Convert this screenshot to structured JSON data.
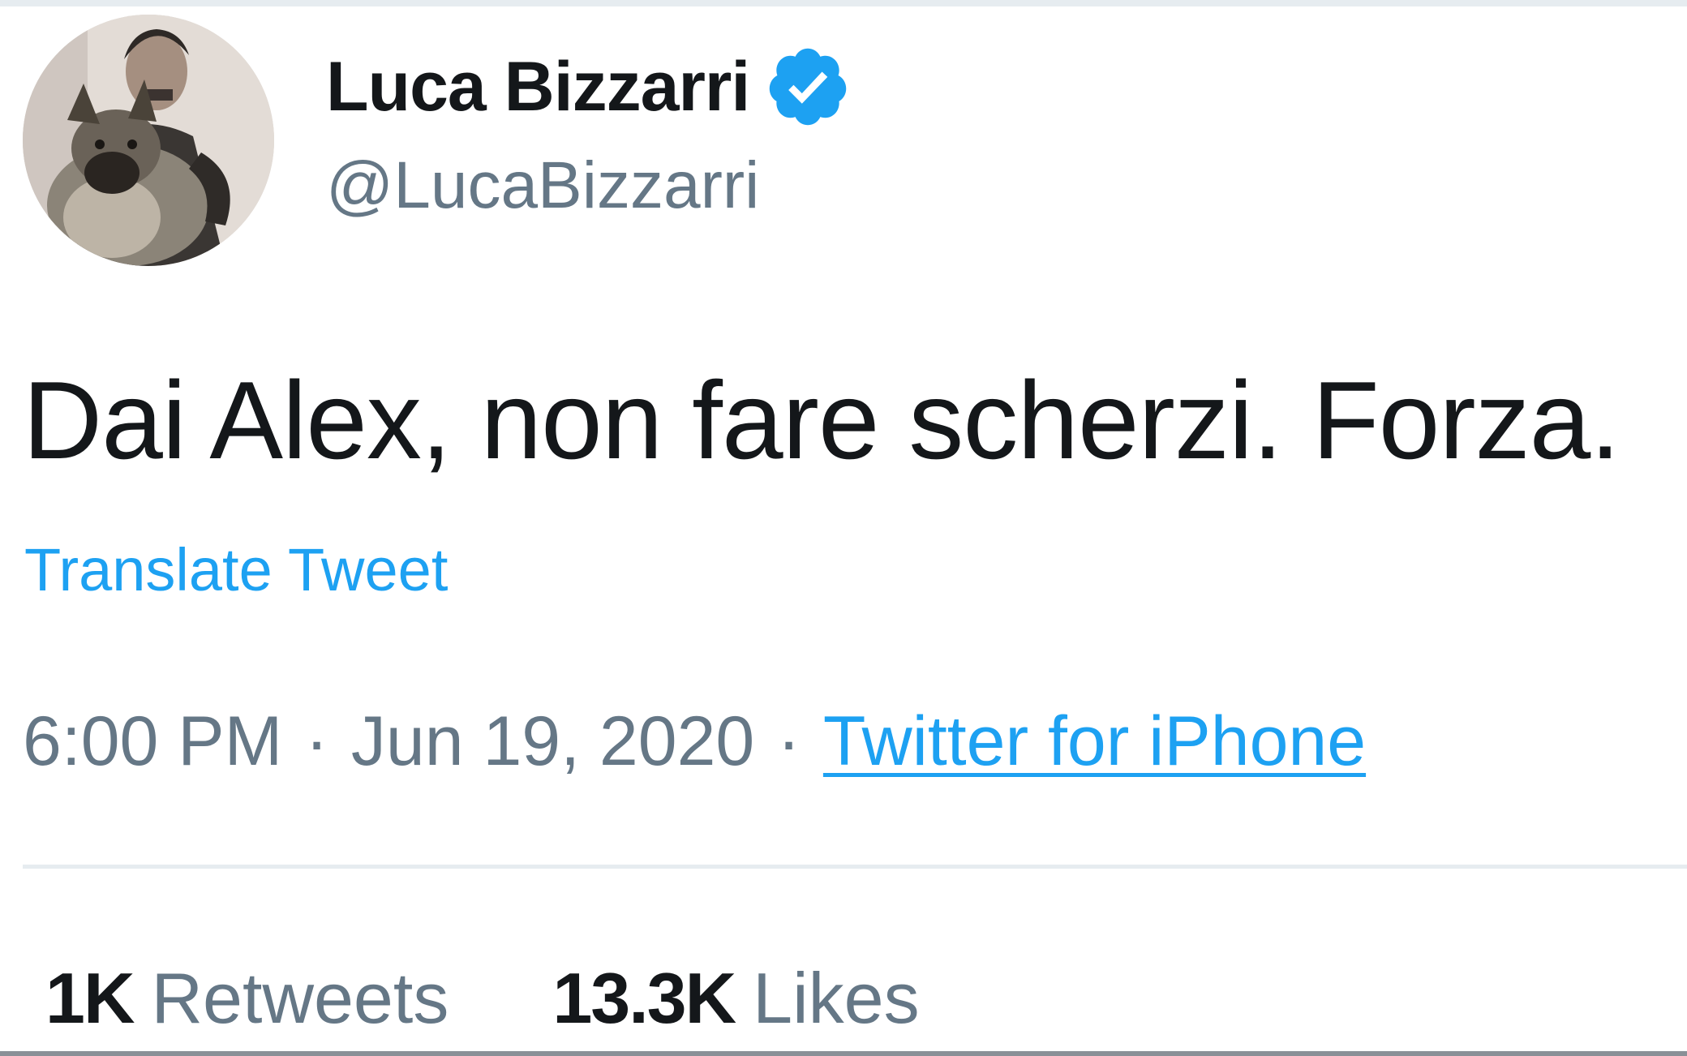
{
  "author": {
    "display_name": "Luca Bizzarri",
    "handle": "@LucaBizzarri",
    "avatar_icon": "profile-photo-man-with-dog",
    "verified_icon": "verified-badge-icon",
    "verified_color": "#1da1f2"
  },
  "tweet": {
    "text": "Dai Alex, non fare scherzi. Forza.",
    "translate_label": "Translate Tweet"
  },
  "meta": {
    "time": "6:00 PM",
    "separator": "·",
    "date": "Jun 19, 2020",
    "source": "Twitter for iPhone"
  },
  "stats": {
    "retweets_count": "1K",
    "retweets_label": "Retweets",
    "likes_count": "13.3K",
    "likes_label": "Likes"
  },
  "colors": {
    "text_primary": "#14171a",
    "text_secondary": "#657786",
    "link": "#1da1f2",
    "divider": "#e6ecf0"
  }
}
